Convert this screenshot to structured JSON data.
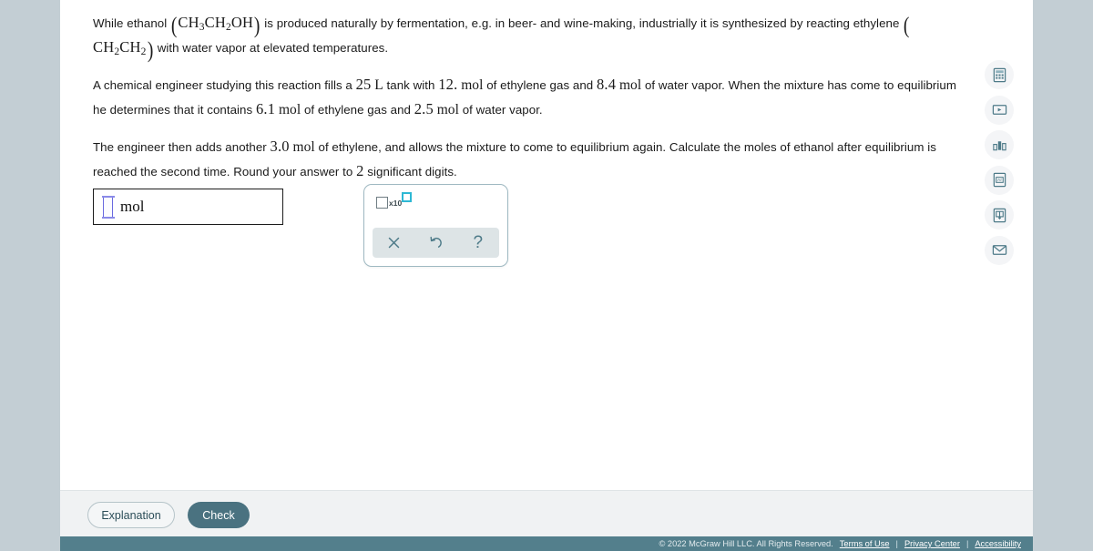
{
  "question": {
    "paragraph1": {
      "seg1": "While ethanol ",
      "formula_ethanol": "CH3CH2OH",
      "seg2": " is produced naturally by fermentation, e.g. in beer- and wine-making, industrially it is synthesized by reacting ethylene ",
      "formula_ethylene": "CH2CH2",
      "seg3": " with water vapor at elevated temperatures."
    },
    "paragraph2": {
      "seg1": "A chemical engineer studying this reaction fills a ",
      "volume": "25",
      "volume_unit": "L",
      "seg2": " tank with ",
      "ethylene_initial": "12.",
      "mol_unit": "mol",
      "seg3": " of ethylene gas and ",
      "water_initial": "8.4",
      "seg4": " of water vapor. When the mixture has come to equilibrium he determines that it contains ",
      "ethylene_eq": "6.1",
      "seg5": " of ethylene gas and ",
      "water_eq": "2.5",
      "seg6": " of water vapor."
    },
    "paragraph3": {
      "seg1": "The engineer then adds another ",
      "ethylene_added": "3.0",
      "mol_unit": "mol",
      "seg2": " of ethylene, and allows the mixture to come to equilibrium again. Calculate the moles of ethanol after equilibrium is reached the second time. Round your answer to ",
      "sig_digits": "2",
      "seg3": " significant digits."
    }
  },
  "answer": {
    "value": "",
    "unit_label": "mol"
  },
  "math_toolbar": {
    "sci_notation": {
      "x10_label": "x10",
      "name": "scientific-notation"
    },
    "buttons": [
      {
        "name": "clear-button",
        "label": "×"
      },
      {
        "name": "undo-button",
        "label": "↺"
      },
      {
        "name": "help-button",
        "label": "?"
      }
    ]
  },
  "side_tools": [
    {
      "name": "calculator-icon",
      "label": "Calculator"
    },
    {
      "name": "video-player-icon",
      "label": "Video"
    },
    {
      "name": "bar-chart-icon",
      "label": "Data"
    },
    {
      "name": "periodic-table-icon",
      "label": "Ar"
    },
    {
      "name": "reference-book-icon",
      "label": "Reference"
    },
    {
      "name": "envelope-icon",
      "label": "Message"
    }
  ],
  "actions": {
    "explanation_label": "Explanation",
    "check_label": "Check"
  },
  "footer": {
    "copyright": "© 2022 McGraw Hill LLC. All Rights Reserved.",
    "links": [
      "Terms of Use",
      "Privacy Center",
      "Accessibility"
    ],
    "separator": "|"
  },
  "colors": {
    "page_background": "#c3ced4",
    "card_background": "#ffffff",
    "footer_bar": "#537f8c",
    "check_button": "#4a7280",
    "accent_teal": "#4d7a88",
    "sci_exponent": "#2eb8d4"
  }
}
